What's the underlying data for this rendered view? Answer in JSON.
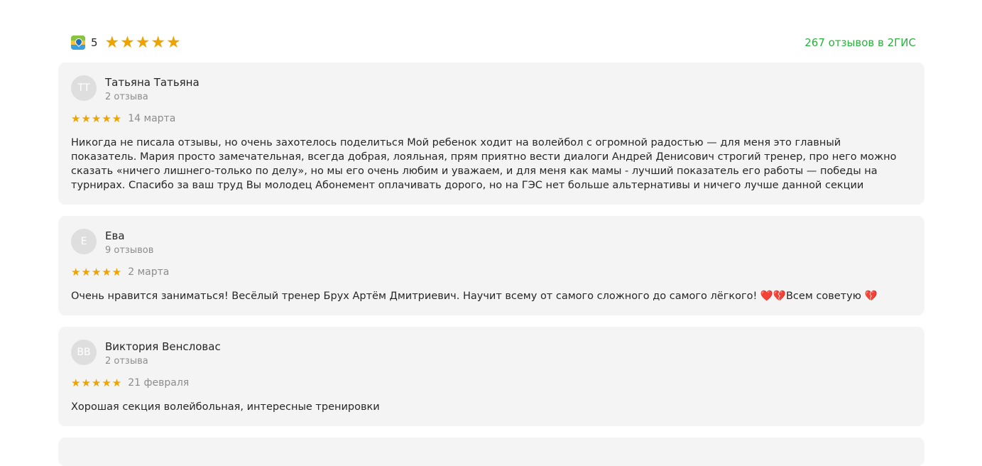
{
  "header": {
    "logo_icon": "2gis-logo-icon",
    "rating": "5",
    "stars": "★★★★★",
    "link_text": "267 отзывов в 2ГИС",
    "colors": {
      "star": "#efa300",
      "link": "#2bb13f"
    }
  },
  "reviews": [
    {
      "initials": "ТТ",
      "name": "Татьяна Татьяна",
      "count": "2 отзыва",
      "stars": "★★★★★",
      "rating": 5,
      "date": "14 марта",
      "text": "Никогда не писала отзывы, но очень захотелось поделиться Мой ребенок ходит на волейбол с огромной радостью — для меня это главный показатель. Мария просто замечательная, всегда добрая, лояльная, прям приятно вести диалоги Андрей Денисович строгий тренер, про него можно сказать «ничего лишнего-только по делу», но мы его очень любим и уважаем, и для меня как мамы - лучший показатель его работы — победы на турнирах. Спасибо за ваш труд Вы молодец Абонемент оплачивать дорого, но на ГЭС нет больше альтернативы и ничего лучше данной секции"
    },
    {
      "initials": "Е",
      "name": "Ева",
      "count": "9 отзывов",
      "stars": "★★★★★",
      "rating": 5,
      "date": "2 марта",
      "text": "Очень нравится заниматься! Весёлый тренер Брух Артём Дмитриевич. Научит всему от самого сложного до самого лёгкого! ❤️💔Всем советую 💔"
    },
    {
      "initials": "ВВ",
      "name": "Виктория Венсловас",
      "count": "2 отзыва",
      "stars": "★★★★★",
      "rating": 5,
      "date": "21 февраля",
      "text": "Хорошая секция волейбольная, интересные тренировки"
    }
  ]
}
